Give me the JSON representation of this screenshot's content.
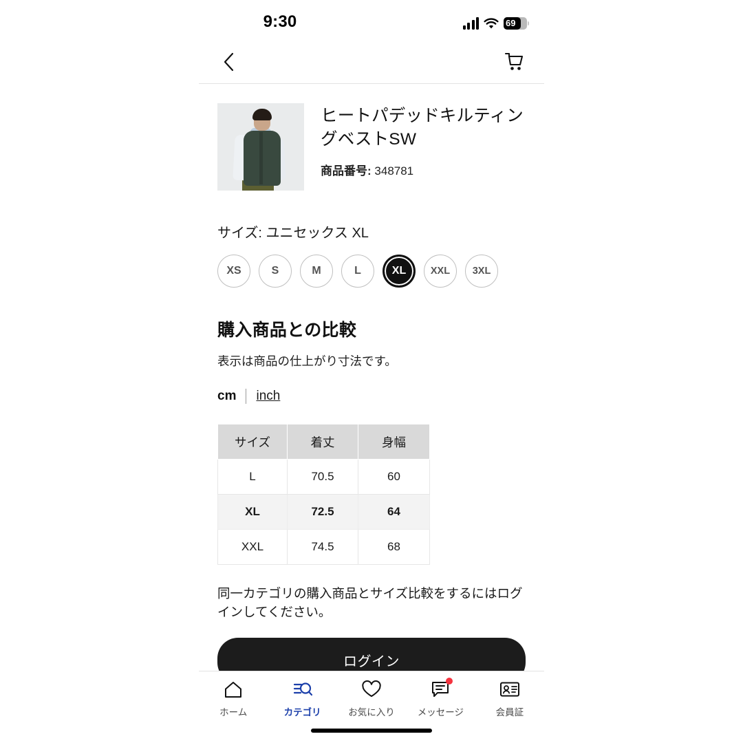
{
  "status_bar": {
    "time": "9:30",
    "battery_level": "69",
    "signal_icon": "cellular-bars-icon",
    "wifi_icon": "wifi-icon",
    "battery_icon": "battery-icon"
  },
  "header": {
    "back_icon": "back-chevron-icon",
    "cart_icon": "shopping-cart-icon"
  },
  "product": {
    "title": "ヒートパデッドキルティングベストSW",
    "code_label": "商品番号:",
    "code_value": "348781",
    "thumbnail_icon": "product-thumbnail-image"
  },
  "size": {
    "label": "サイズ: ユニセックス XL",
    "options": [
      {
        "label": "XS",
        "selected": false
      },
      {
        "label": "S",
        "selected": false
      },
      {
        "label": "M",
        "selected": false
      },
      {
        "label": "L",
        "selected": false
      },
      {
        "label": "XL",
        "selected": true
      },
      {
        "label": "XXL",
        "selected": false
      },
      {
        "label": "3XL",
        "selected": false
      }
    ]
  },
  "compare": {
    "heading": "購入商品との比較",
    "subtext": "表示は商品の仕上がり寸法です。",
    "unit_cm": "cm",
    "unit_inch": "inch",
    "active_unit": "cm"
  },
  "table": {
    "headers": [
      "サイズ",
      "着丈",
      "身幅"
    ],
    "rows": [
      {
        "cells": [
          "L",
          "70.5",
          "60"
        ],
        "highlighted": false
      },
      {
        "cells": [
          "XL",
          "72.5",
          "64"
        ],
        "highlighted": true
      },
      {
        "cells": [
          "XXL",
          "74.5",
          "68"
        ],
        "highlighted": false
      }
    ]
  },
  "login": {
    "note": "同一カテゴリの購入商品とサイズ比較をするにはログインしてください。",
    "button_label": "ログイン"
  },
  "tabbar": {
    "items": [
      {
        "label": "ホーム",
        "icon": "home-icon",
        "active": false,
        "badge": false
      },
      {
        "label": "カテゴリ",
        "icon": "category-search-icon",
        "active": true,
        "badge": false
      },
      {
        "label": "お気に入り",
        "icon": "heart-icon",
        "active": false,
        "badge": false
      },
      {
        "label": "メッセージ",
        "icon": "message-bubble-icon",
        "active": false,
        "badge": true
      },
      {
        "label": "会員証",
        "icon": "membership-card-icon",
        "active": false,
        "badge": false
      }
    ]
  },
  "colors": {
    "accent_blue": "#1b3faa",
    "badge_red": "#f5333f",
    "button_black": "#1c1c1c",
    "table_header_bg": "#d9d9d9",
    "table_highlight_bg": "#f3f3f3"
  }
}
